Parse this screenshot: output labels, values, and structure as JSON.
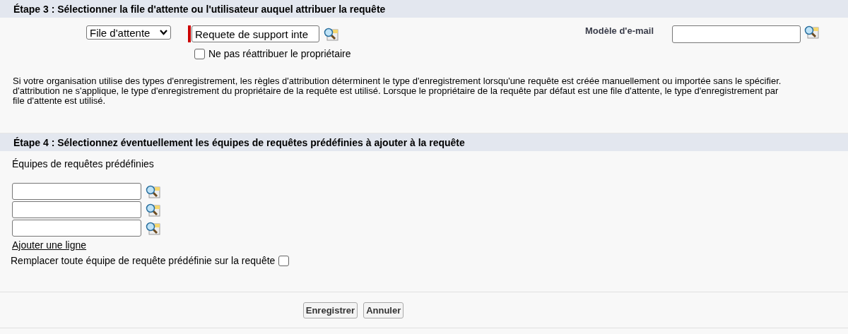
{
  "step3": {
    "title": "Étape 3 : Sélectionner la file d'attente ou l'utilisateur auquel attribuer la requête",
    "owner_type": {
      "value": "File d'attente"
    },
    "owner": {
      "value": "Requete de support inte",
      "required": true
    },
    "no_reassign": {
      "label": "Ne pas réattribuer le propriétaire",
      "checked": false
    },
    "email_template": {
      "label": "Modèle d'e-mail"
    },
    "note_lines": [
      "Si votre organisation utilise des types d'enregistrement, les règles d'attribution déterminent le type d'enregistrement lorsqu'une requête est créée manuellement ou importée sans le spécifier.",
      "d'attribution ne s'applique, le type d'enregistrement du propriétaire de la requête est utilisé. Lorsque le propriétaire de la requête par défaut est une file d'attente, le type d'enregistrement par",
      "file d'attente est utilisé."
    ]
  },
  "step4": {
    "title": "Étape 4 : Sélectionnez éventuellement les équipes de requêtes prédéfinies à ajouter à la requête",
    "label": "Équipes de requêtes prédéfinies",
    "teams": [
      {
        "kind": "lookup"
      },
      {
        "kind": "lookup"
      },
      {
        "kind": "lookup"
      }
    ],
    "add_row": "Ajouter une ligne",
    "replace": {
      "label": "Remplacer toute équipe de requête prédéfinie sur la requête",
      "checked": false
    }
  },
  "buttons": [
    "Enregistrer",
    "Annuler"
  ]
}
